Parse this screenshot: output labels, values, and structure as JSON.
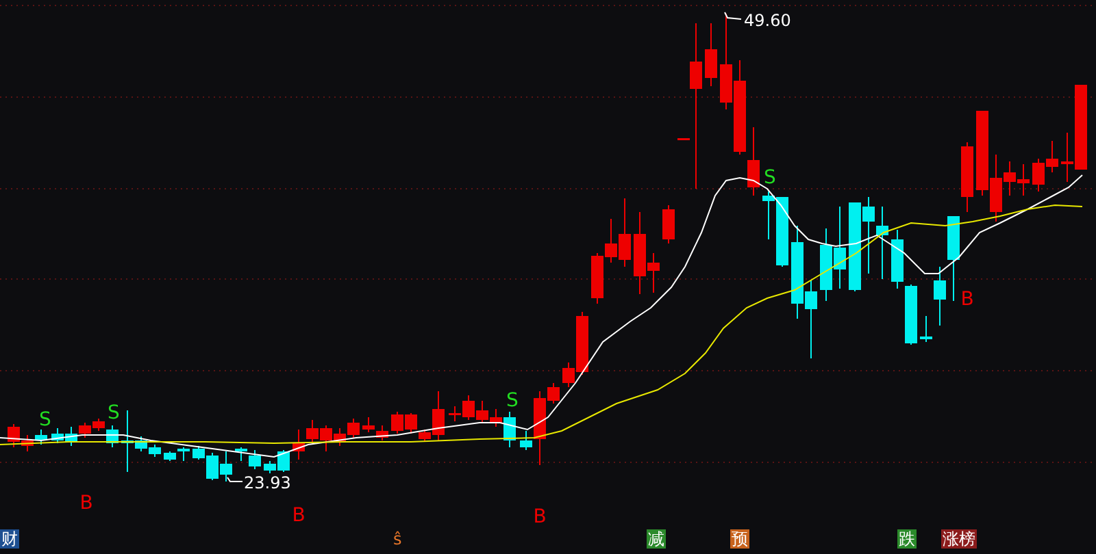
{
  "chart": {
    "high_label": "49.60",
    "low_label": "23.93",
    "signals": [
      {
        "kind": "sell",
        "text": "S"
      },
      {
        "kind": "sell",
        "text": "S"
      },
      {
        "kind": "sell",
        "text": "S"
      },
      {
        "kind": "sell",
        "text": "S"
      },
      {
        "kind": "buy",
        "text": "B"
      },
      {
        "kind": "buy",
        "text": "B"
      },
      {
        "kind": "buy",
        "text": "B"
      },
      {
        "kind": "buy",
        "text": "B"
      }
    ]
  },
  "event_badges": [
    {
      "kind": "tag",
      "text": "财",
      "color": "#1d4f91"
    },
    {
      "kind": "text",
      "text": "ŝ",
      "color": "#e8762a"
    },
    {
      "kind": "tag",
      "text": "减",
      "color": "#2b8a2b"
    },
    {
      "kind": "tag",
      "text": "预",
      "color": "#c8621c"
    },
    {
      "kind": "tag",
      "text": "跌",
      "color": "#2b8a2b"
    },
    {
      "kind": "tag",
      "text": "涨榜",
      "color": "#8c1c1c"
    }
  ]
}
